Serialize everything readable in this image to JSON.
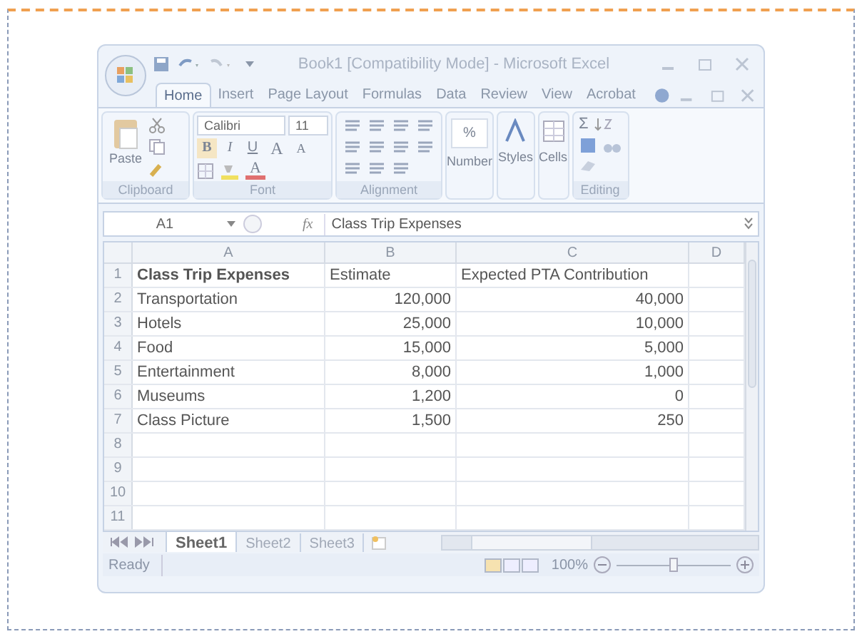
{
  "window": {
    "title": "Book1  [Compatibility Mode] - Microsoft Excel"
  },
  "tabs": [
    {
      "label": "Home",
      "selected": true
    },
    {
      "label": "Insert",
      "selected": false
    },
    {
      "label": "Page Layout",
      "selected": false
    },
    {
      "label": "Formulas",
      "selected": false
    },
    {
      "label": "Data",
      "selected": false
    },
    {
      "label": "Review",
      "selected": false
    },
    {
      "label": "View",
      "selected": false
    },
    {
      "label": "Acrobat",
      "selected": false
    }
  ],
  "ribbon": {
    "paste": "Paste",
    "font_name": "Calibri",
    "font_size": "11",
    "bold": "B",
    "italic": "I",
    "underline": "U",
    "grow": "A",
    "shrink": "A",
    "font_color": "A",
    "number": "Number",
    "percent": "%",
    "styles": "Styles",
    "cells": "Cells",
    "sum": "Σ",
    "groups": [
      "Clipboard",
      "Font",
      "Alignment",
      "Editing"
    ]
  },
  "name_box": "A1",
  "fx": "fx",
  "formula": "Class Trip Expenses",
  "columns": [
    "A",
    "B",
    "C",
    "D"
  ],
  "rows": [
    {
      "number": "1",
      "cells": [
        {
          "text": "Class Trip Expenses",
          "bold": true
        },
        {
          "text": "Estimate",
          "bold": false
        },
        {
          "text": "Expected PTA Contribution",
          "bold": false
        }
      ]
    },
    {
      "number": "2",
      "cells": [
        {
          "text": "Transportation",
          "bold": false
        },
        {
          "text": "120,000",
          "bold": false
        },
        {
          "text": "40,000",
          "bold": false
        }
      ]
    },
    {
      "number": "3",
      "cells": [
        {
          "text": "Hotels",
          "bold": false
        },
        {
          "text": "25,000",
          "bold": false
        },
        {
          "text": "10,000",
          "bold": false
        }
      ]
    },
    {
      "number": "4",
      "cells": [
        {
          "text": "Food",
          "bold": false
        },
        {
          "text": "15,000",
          "bold": false
        },
        {
          "text": "5,000",
          "bold": false
        }
      ]
    },
    {
      "number": "5",
      "cells": [
        {
          "text": "Entertainment",
          "bold": false
        },
        {
          "text": "8,000",
          "bold": false
        },
        {
          "text": "1,000",
          "bold": false
        }
      ]
    },
    {
      "number": "6",
      "cells": [
        {
          "text": "Museums",
          "bold": false
        },
        {
          "text": "1,200",
          "bold": false
        },
        {
          "text": "0",
          "bold": false
        }
      ]
    },
    {
      "number": "7",
      "cells": [
        {
          "text": "Class Picture",
          "bold": false
        },
        {
          "text": "1,500",
          "bold": false
        },
        {
          "text": "250",
          "bold": false
        }
      ]
    },
    {
      "number": "8",
      "cells": []
    },
    {
      "number": "9",
      "cells": []
    },
    {
      "number": "10",
      "cells": []
    },
    {
      "number": "11",
      "cells": []
    }
  ],
  "sheets": [
    {
      "label": "Sheet1",
      "selected": true
    },
    {
      "label": "Sheet2",
      "selected": false
    },
    {
      "label": "Sheet3",
      "selected": false
    }
  ],
  "status_bar": {
    "text": "Ready",
    "zoom": "100%",
    "zoom_slider": {
      "level": 0.5
    }
  }
}
